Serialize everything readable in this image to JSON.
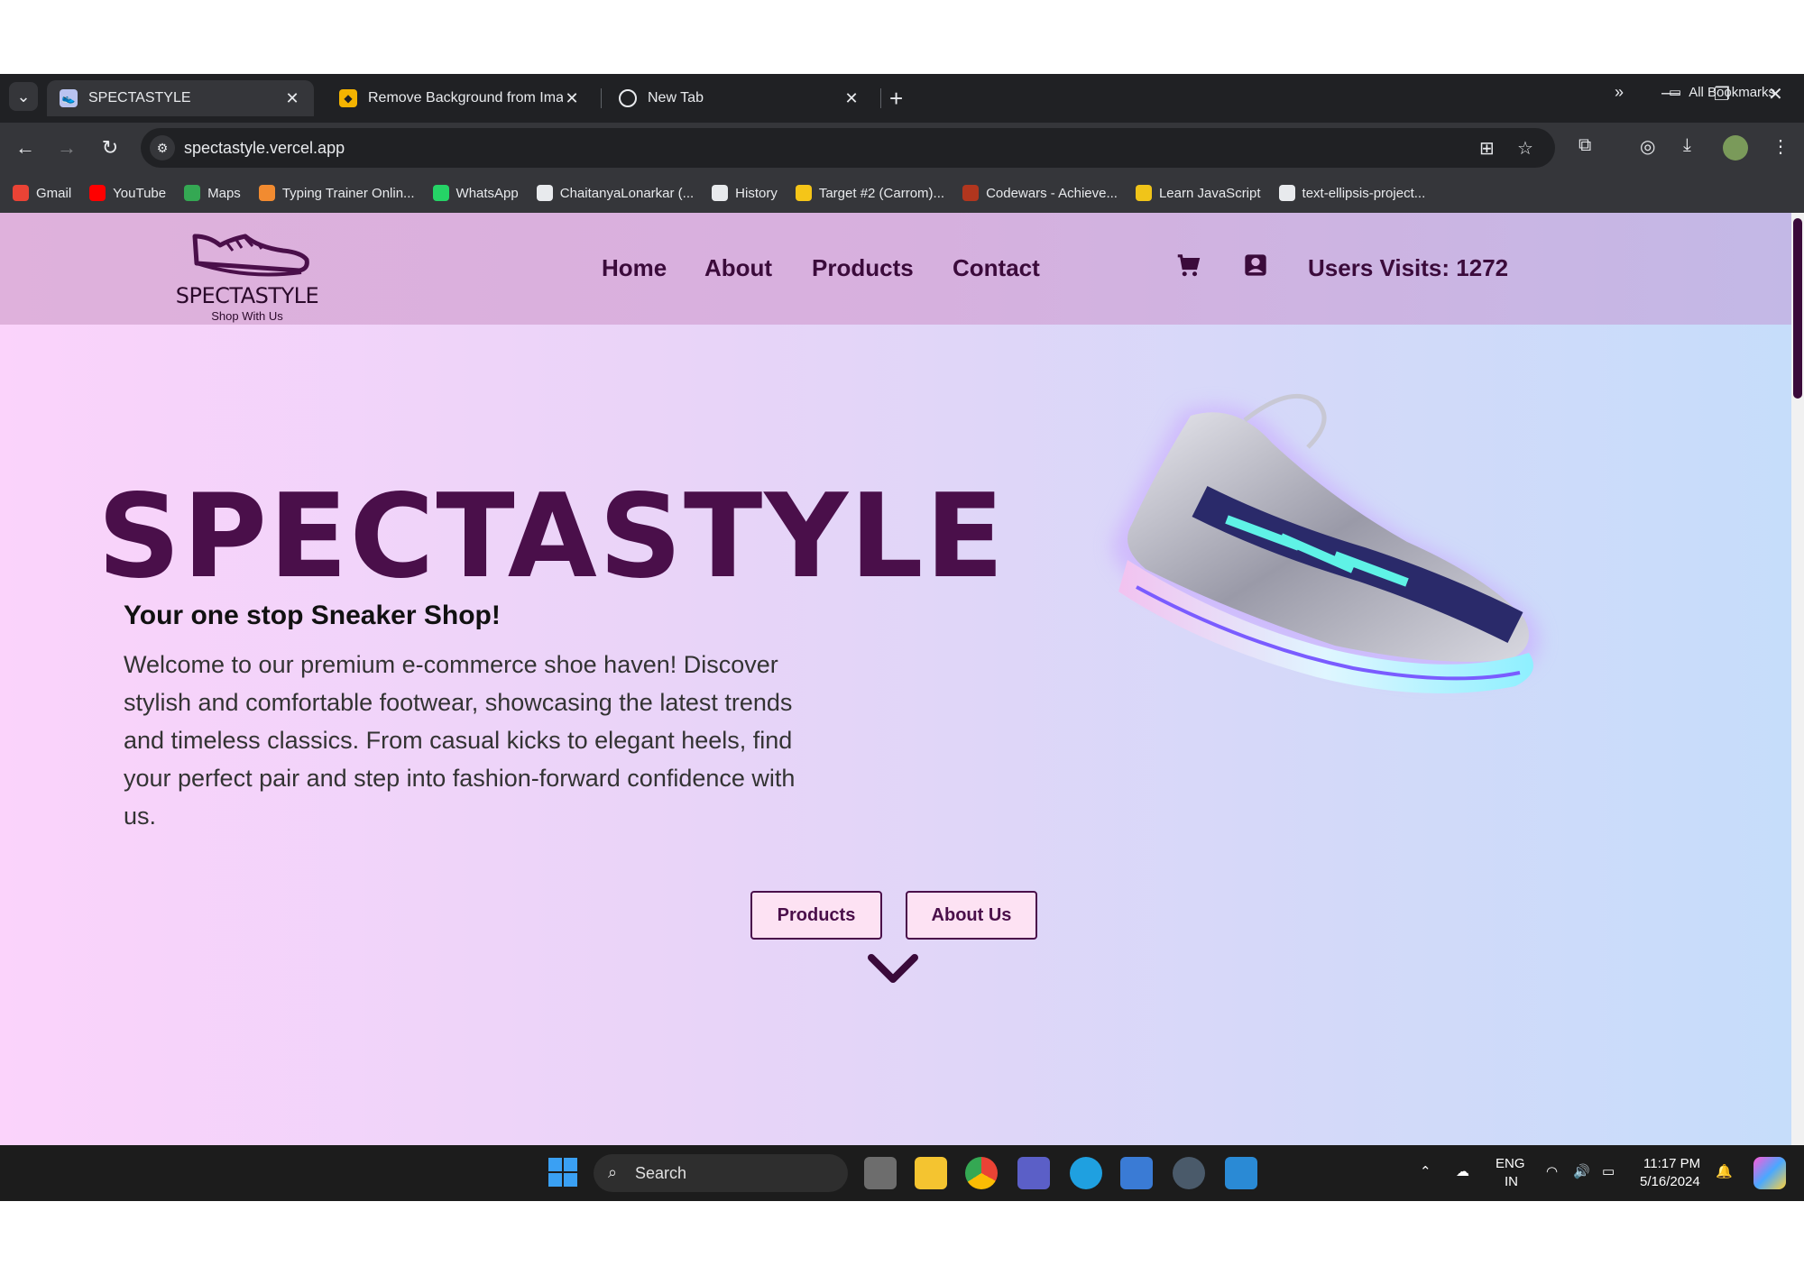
{
  "browser": {
    "tabs": [
      {
        "title": "SPECTASTYLE",
        "active": true
      },
      {
        "title": "Remove Background from Imag",
        "active": false
      },
      {
        "title": "New Tab",
        "active": false
      }
    ],
    "url": "spectastyle.vercel.app",
    "bookmarks": [
      {
        "label": "Gmail",
        "icon": "gmail-icon",
        "color": "#ea4335"
      },
      {
        "label": "YouTube",
        "icon": "youtube-icon",
        "color": "#ff0000"
      },
      {
        "label": "Maps",
        "icon": "maps-icon",
        "color": "#34a853"
      },
      {
        "label": "Typing Trainer Onlin...",
        "icon": "typing-trainer-icon",
        "color": "#f28b30"
      },
      {
        "label": "WhatsApp",
        "icon": "whatsapp-icon",
        "color": "#25d366"
      },
      {
        "label": "ChaitanyaLonarkar (...",
        "icon": "github-icon",
        "color": "#e8eaed"
      },
      {
        "label": "History",
        "icon": "history-icon",
        "color": "#e8eaed"
      },
      {
        "label": "Target #2 (Carrom)...",
        "icon": "target-icon",
        "color": "#f5c518"
      },
      {
        "label": "Codewars - Achieve...",
        "icon": "codewars-icon",
        "color": "#b1361e"
      },
      {
        "label": "Learn JavaScript",
        "icon": "javascript-icon",
        "color": "#f0c419"
      },
      {
        "label": "text-ellipsis-project...",
        "icon": "page-icon",
        "color": "#e8eaed"
      }
    ],
    "all_bookmarks": "All Bookmarks"
  },
  "site": {
    "logo_text": "SPECTASTYLE",
    "logo_tagline": "Shop With Us",
    "nav": [
      "Home",
      "About",
      "Products",
      "Contact"
    ],
    "visits": "Users Visits: 1272",
    "hero": {
      "title": "SPECTASTYLE",
      "subtitle": "Your one stop Sneaker Shop!",
      "body": "Welcome to our premium e-commerce shoe haven! Discover stylish and comfortable footwear, showcasing the latest trends and timeless classics. From casual kicks to elegant heels, find your perfect pair and step into fashion-forward confidence with us.",
      "btn_products": "Products",
      "btn_about": "About Us"
    },
    "colors": {
      "brand": "#4a0f4a",
      "button_bg": "#fde2f3"
    }
  },
  "taskbar": {
    "search_label": "Search",
    "lang_top": "ENG",
    "lang_bottom": "IN",
    "time": "11:17 PM",
    "date": "5/16/2024"
  }
}
